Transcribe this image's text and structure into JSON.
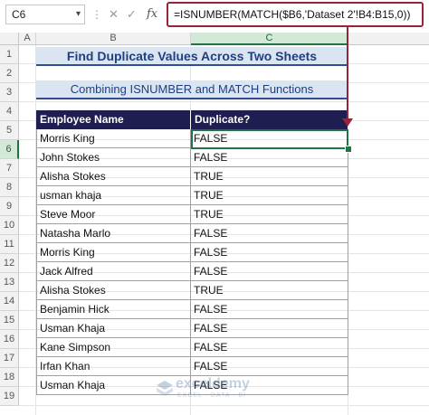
{
  "formula_bar": {
    "name_box": "C6",
    "fx_label": "fx",
    "formula": "=ISNUMBER(MATCH($B6,'Dataset 2'!B4:B15,0))"
  },
  "columns": [
    "A",
    "B",
    "C"
  ],
  "rows": [
    "1",
    "2",
    "3",
    "4",
    "5",
    "6",
    "7",
    "8",
    "9",
    "10",
    "11",
    "12",
    "13",
    "14",
    "15",
    "16",
    "17",
    "18",
    "19"
  ],
  "sheet": {
    "title": "Find Duplicate Values Across Two Sheets",
    "subtitle": "Combining ISNUMBER and MATCH Functions",
    "table": {
      "headers": [
        "Employee Name",
        "Duplicate?"
      ],
      "rows": [
        [
          "Morris King",
          "FALSE"
        ],
        [
          "John Stokes",
          "FALSE"
        ],
        [
          "Alisha Stokes",
          "TRUE"
        ],
        [
          "usman khaja",
          "TRUE"
        ],
        [
          "Steve Moor",
          "TRUE"
        ],
        [
          "Natasha Marlo",
          "FALSE"
        ],
        [
          "Morris King",
          "FALSE"
        ],
        [
          "Jack Alfred",
          "FALSE"
        ],
        [
          "Alisha Stokes",
          "TRUE"
        ],
        [
          "Benjamin Hick",
          "FALSE"
        ],
        [
          "Usman Khaja",
          "FALSE"
        ],
        [
          "Kane Simpson",
          "FALSE"
        ],
        [
          "Irfan Khan",
          "FALSE"
        ],
        [
          "Usman Khaja",
          "FALSE"
        ]
      ]
    }
  },
  "watermark": {
    "name": "exceldemy",
    "tagline": "EXCEL · DATA · BI"
  },
  "colors": {
    "accent": "#217346",
    "callout": "#9b2335",
    "header_fill": "#1e1e50",
    "title_fill": "#dbe5f1"
  }
}
